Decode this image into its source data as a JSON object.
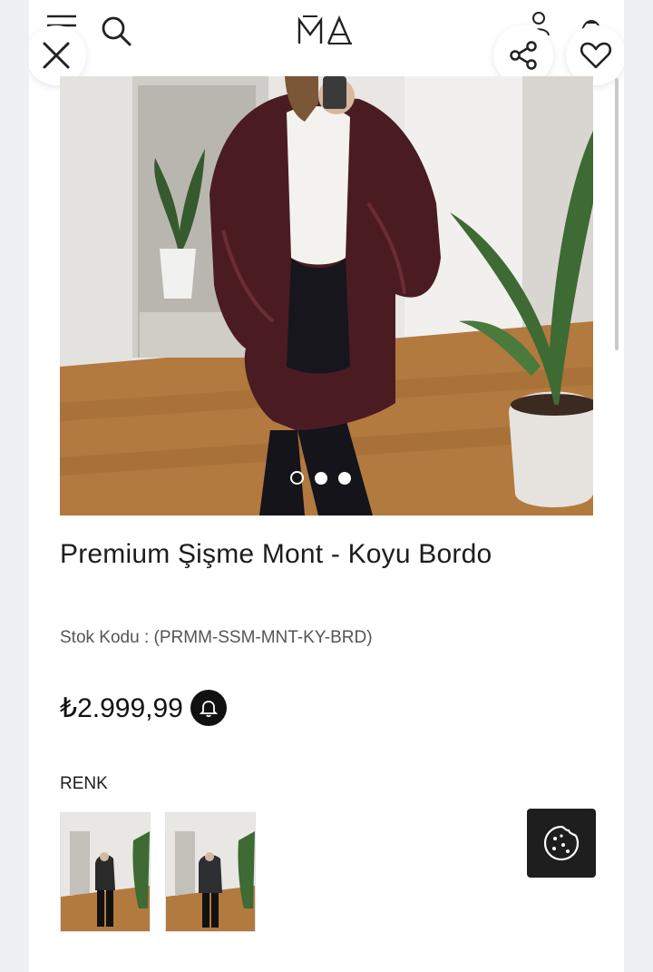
{
  "header": {
    "logo_text": "MA",
    "menu_icon": "menu-icon",
    "search_icon": "search-icon",
    "account_icon": "user-icon",
    "cart_icon": "bag-icon"
  },
  "overlay_actions": {
    "close_icon": "close-icon",
    "share_icon": "share-icon",
    "favorite_icon": "heart-icon"
  },
  "gallery": {
    "image_count": 3,
    "active_index": 0
  },
  "product": {
    "title": "Premium Şişme Mont - Koyu Bordo",
    "sku_label": "Stok Kodu :",
    "sku_value": "(PRMM-SSM-MNT-KY-BRD)",
    "price": "₺2.999,99",
    "price_alert_icon": "bell-icon"
  },
  "color_section": {
    "label": "RENK",
    "options": [
      "color-option-1",
      "color-option-2"
    ]
  },
  "cookie": {
    "icon": "cookie-icon"
  },
  "colors": {
    "background": "#eef0f1",
    "card": "#ffffff",
    "text": "#1d1d1d",
    "muted": "#555555",
    "dark": "#111111",
    "jacket": "#4a1c22"
  }
}
